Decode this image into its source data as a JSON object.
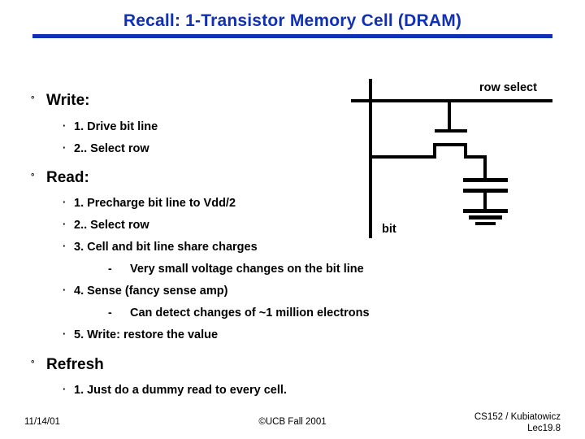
{
  "slide": {
    "title": "Recall: 1-Transistor Memory Cell (DRAM)",
    "accent_color": "#1131B5",
    "text_color": "#000000",
    "background_color": "#ffffff"
  },
  "bullets": {
    "marker_level1": "°",
    "marker_level2": "·",
    "marker_level3": "-"
  },
  "sections": [
    {
      "heading": "Write:",
      "items": [
        "1. Drive bit line",
        "2.. Select row"
      ]
    },
    {
      "heading": "Read:",
      "items": [
        "1. Precharge bit line to Vdd/2",
        "2.. Select row",
        "3. Cell and bit line share charges",
        "4. Sense (fancy sense amp)",
        "5. Write: restore the value"
      ],
      "subitems": [
        "Very small voltage changes on the bit line",
        "Can detect changes of ~1 million  electrons"
      ]
    },
    {
      "heading": "Refresh",
      "items": [
        "1. Just do a dummy read to every cell."
      ]
    }
  ],
  "circuit": {
    "row_select_label": "row select",
    "bit_label": "bit"
  },
  "footer": {
    "date": "11/14/01",
    "center": "©UCB Fall 2001",
    "course": "CS152 / Kubiatowicz",
    "lecture": "Lec19.8"
  }
}
